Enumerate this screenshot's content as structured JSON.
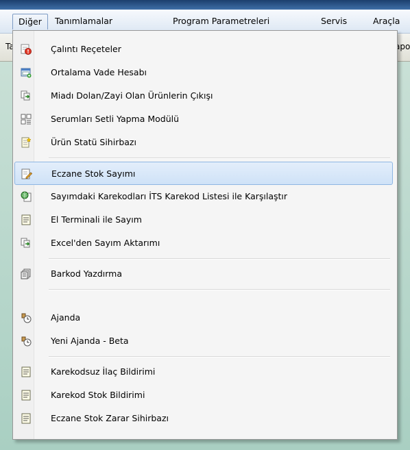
{
  "menubar": {
    "items": [
      {
        "label": "Diğer"
      },
      {
        "label": "Tanımlamalar"
      },
      {
        "label": "Program Parametreleri"
      },
      {
        "label": "Servis"
      },
      {
        "label": "Araçla"
      }
    ]
  },
  "toolbar": {
    "left_fragment": "Ta",
    "right_fragment": "apo"
  },
  "menu": {
    "items": [
      {
        "label": "Çalıntı Reçeteler",
        "icon": "stolen-prescription-icon"
      },
      {
        "label": "Ortalama Vade Hesabı",
        "icon": "calculator-window-icon"
      },
      {
        "label": "Miadı Dolan/Zayi Olan Ürünlerin Çıkışı",
        "icon": "export-documents-icon"
      },
      {
        "label": "Serumları Setli Yapma Modülü",
        "icon": "serum-set-icon"
      },
      {
        "label": "Ürün Statü Sihirbazı",
        "icon": "wizard-document-icon"
      },
      {
        "label": "Eczane Stok Sayımı",
        "icon": "stock-count-icon"
      },
      {
        "label": "Sayımdaki Karekodları İTS Karekod Listesi ile Karşılaştır",
        "icon": "compare-globe-icon"
      },
      {
        "label": "El Terminali ile Sayım",
        "icon": "document-icon"
      },
      {
        "label": "Excel'den Sayım Aktarımı",
        "icon": "export-documents-icon"
      },
      {
        "label": "Barkod Yazdırma",
        "icon": "print-barcode-icon"
      },
      {
        "label": "Ajanda",
        "icon": "agenda-clock-icon"
      },
      {
        "label": "Yeni Ajanda - Beta",
        "icon": "agenda-clock-icon"
      },
      {
        "label": "Karekodsuz İlaç Bildirimi",
        "icon": "document-icon"
      },
      {
        "label": "Karekod Stok Bildirimi",
        "icon": "document-icon"
      },
      {
        "label": "Eczane Stok Zarar Sihirbazı",
        "icon": "document-icon"
      }
    ]
  }
}
